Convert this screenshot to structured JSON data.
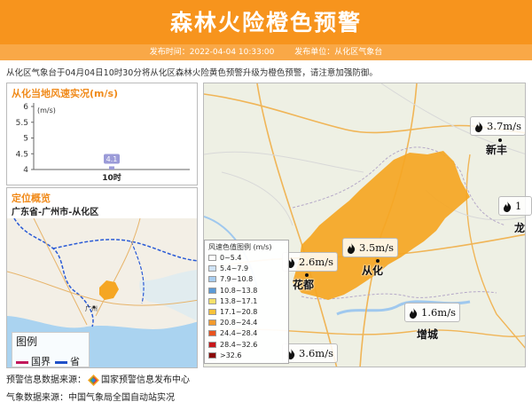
{
  "header": {
    "title": "森林火险橙色预警",
    "publish_time": "发布时间：2022-04-04 10:33:00",
    "publisher": "发布单位：从化区气象台"
  },
  "notice": "从化区气象台于04月04日10时30分将从化区森林火险黄色预警升级为橙色预警，请注意加强防御。",
  "speed_panel": {
    "title": "从化当地风速实况(m/s)",
    "chart_data": {
      "type": "bar",
      "categories": [
        "10时"
      ],
      "values": [
        4.1
      ],
      "ylabel": "(m/s)",
      "yticks": [
        "6",
        "5.5",
        "5",
        "4.5",
        "4"
      ],
      "ylim": [
        4,
        6
      ],
      "data_labels": [
        "4.1"
      ],
      "bar_color": "#9b9bd8"
    }
  },
  "location_panel": {
    "title": "定位概览",
    "location": "广东省-广州市-从化区",
    "map_city_label": "广州",
    "legend": {
      "title": "图例",
      "national_border": "国界",
      "provincial_border": "省界"
    }
  },
  "wind_legend": {
    "title": "风速色值图例 (m/s)",
    "items": [
      {
        "label": "0~5.4",
        "color": "#ffffff"
      },
      {
        "label": "5.4~7.9",
        "color": "#cfe3f5"
      },
      {
        "label": "7.9~10.8",
        "color": "#a8cdef"
      },
      {
        "label": "10.8~13.8",
        "color": "#5b9ad6"
      },
      {
        "label": "13.8~17.1",
        "color": "#f5e16a"
      },
      {
        "label": "17.1~20.8",
        "color": "#f7c23a"
      },
      {
        "label": "20.8~24.4",
        "color": "#f29a2e"
      },
      {
        "label": "24.4~28.4",
        "color": "#e8531f"
      },
      {
        "label": "28.4~32.6",
        "color": "#c8181c"
      },
      {
        "label": ">32.6",
        "color": "#8a0a0a"
      }
    ]
  },
  "stations": [
    {
      "value": "3.7m/s"
    },
    {
      "value": "1"
    },
    {
      "value": "3.5m/s"
    },
    {
      "value": "2.6m/s"
    },
    {
      "value": "1.6m/s"
    },
    {
      "value": "3.6m/s"
    }
  ],
  "places": {
    "xinfeng": "新丰",
    "conghua": "从化",
    "huadu": "花都",
    "zengcheng": "增城",
    "long": "龙"
  },
  "footer": {
    "warning_source": "预警信息数据来源：",
    "warning_source_name": "国家预警信息发布中心",
    "weather_source": "气象数据来源：中国气象局全国自动站实况"
  },
  "colors": {
    "header": "#f7941d",
    "panel_title": "#f08a1a",
    "warning_area": "#f5a623"
  }
}
